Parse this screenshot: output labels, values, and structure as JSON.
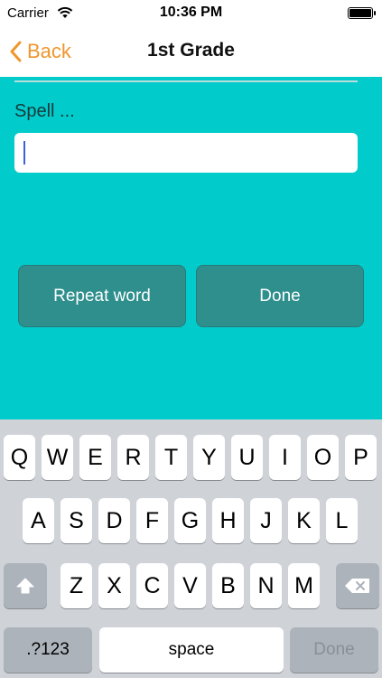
{
  "status_bar": {
    "carrier": "Carrier",
    "time": "10:36 PM",
    "battery_level": 1.0
  },
  "nav": {
    "back_label": "Back",
    "title": "1st Grade"
  },
  "main": {
    "prompt": "Spell ...",
    "answer": {
      "value": "",
      "placeholder": ""
    },
    "repeat_label": "Repeat word",
    "done_label": "Done"
  },
  "keyboard": {
    "row1": [
      "Q",
      "W",
      "E",
      "R",
      "T",
      "Y",
      "U",
      "I",
      "O",
      "P"
    ],
    "row2": [
      "A",
      "S",
      "D",
      "F",
      "G",
      "H",
      "J",
      "K",
      "L"
    ],
    "row3": [
      "Z",
      "X",
      "C",
      "V",
      "B",
      "N",
      "M"
    ],
    "numbers_label": ".?123",
    "space_label": "space",
    "done_label": "Done"
  },
  "colors": {
    "accent": "#f0962d",
    "background": "#02cccb",
    "button": "#2e8f8d"
  }
}
